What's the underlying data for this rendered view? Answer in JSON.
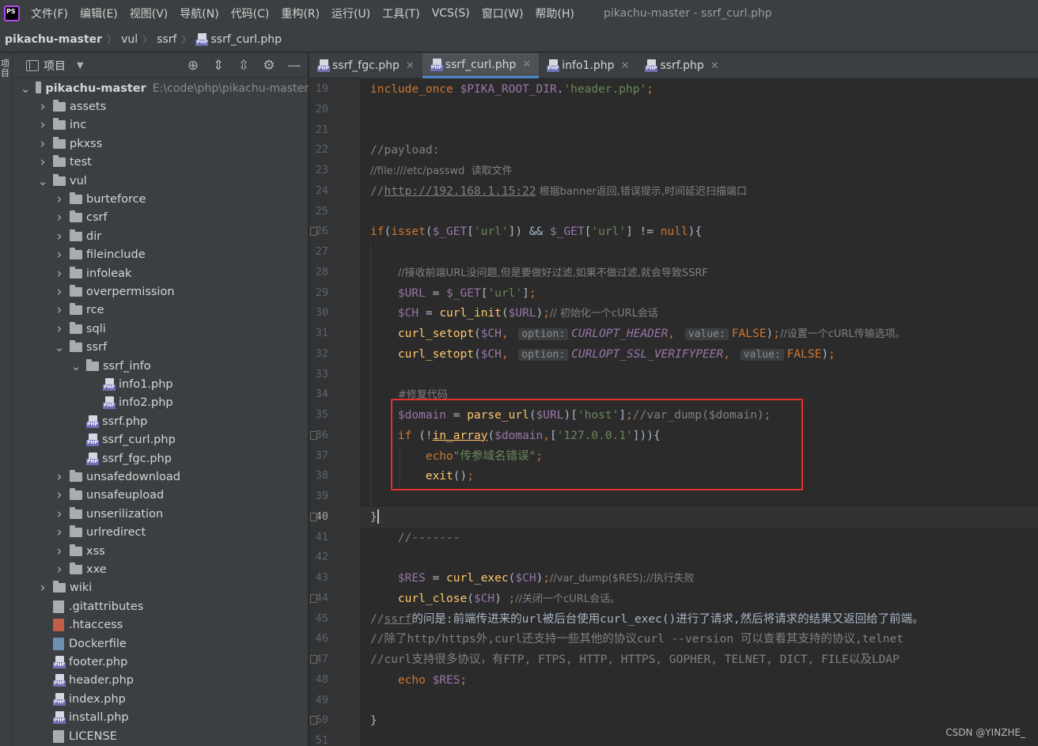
{
  "menubar": {
    "items": [
      "文件(F)",
      "编辑(E)",
      "视图(V)",
      "导航(N)",
      "代码(C)",
      "重构(R)",
      "运行(U)",
      "工具(T)",
      "VCS(S)",
      "窗口(W)",
      "帮助(H)"
    ],
    "window_title": "pikachu-master - ssrf_curl.php"
  },
  "breadcrumb": [
    "pikachu-master",
    "vul",
    "ssrf",
    "ssrf_curl.php"
  ],
  "left_strip_label": "项目",
  "project": {
    "label": "项目",
    "tree": [
      {
        "label": "pikachu-master",
        "path": "E:\\code\\php\\pikachu-master",
        "type": "folder",
        "depth": 0,
        "open": true
      },
      {
        "label": "assets",
        "type": "folder",
        "depth": 1
      },
      {
        "label": "inc",
        "type": "folder",
        "depth": 1
      },
      {
        "label": "pkxss",
        "type": "folder",
        "depth": 1
      },
      {
        "label": "test",
        "type": "folder",
        "depth": 1
      },
      {
        "label": "vul",
        "type": "folder",
        "depth": 1,
        "open": true
      },
      {
        "label": "burteforce",
        "type": "folder",
        "depth": 2
      },
      {
        "label": "csrf",
        "type": "folder",
        "depth": 2
      },
      {
        "label": "dir",
        "type": "folder",
        "depth": 2
      },
      {
        "label": "fileinclude",
        "type": "folder",
        "depth": 2
      },
      {
        "label": "infoleak",
        "type": "folder",
        "depth": 2
      },
      {
        "label": "overpermission",
        "type": "folder",
        "depth": 2
      },
      {
        "label": "rce",
        "type": "folder",
        "depth": 2
      },
      {
        "label": "sqli",
        "type": "folder",
        "depth": 2
      },
      {
        "label": "ssrf",
        "type": "folder",
        "depth": 2,
        "open": true
      },
      {
        "label": "ssrf_info",
        "type": "folder",
        "depth": 3,
        "open": true
      },
      {
        "label": "info1.php",
        "type": "php",
        "depth": 4
      },
      {
        "label": "info2.php",
        "type": "php",
        "depth": 4
      },
      {
        "label": "ssrf.php",
        "type": "php",
        "depth": 3
      },
      {
        "label": "ssrf_curl.php",
        "type": "php",
        "depth": 3
      },
      {
        "label": "ssrf_fgc.php",
        "type": "php",
        "depth": 3
      },
      {
        "label": "unsafedownload",
        "type": "folder",
        "depth": 2
      },
      {
        "label": "unsafeupload",
        "type": "folder",
        "depth": 2
      },
      {
        "label": "unserilization",
        "type": "folder",
        "depth": 2
      },
      {
        "label": "urlredirect",
        "type": "folder",
        "depth": 2
      },
      {
        "label": "xss",
        "type": "folder",
        "depth": 2
      },
      {
        "label": "xxe",
        "type": "folder",
        "depth": 2
      },
      {
        "label": "wiki",
        "type": "folder",
        "depth": 1
      },
      {
        "label": ".gitattributes",
        "type": "file",
        "depth": 1
      },
      {
        "label": ".htaccess",
        "type": "htaccess",
        "depth": 1
      },
      {
        "label": "Dockerfile",
        "type": "docker",
        "depth": 1
      },
      {
        "label": "footer.php",
        "type": "php",
        "depth": 1
      },
      {
        "label": "header.php",
        "type": "php",
        "depth": 1
      },
      {
        "label": "index.php",
        "type": "php",
        "depth": 1
      },
      {
        "label": "install.php",
        "type": "php",
        "depth": 1
      },
      {
        "label": "LICENSE",
        "type": "file",
        "depth": 1
      }
    ]
  },
  "tabs": [
    {
      "label": "ssrf_fgc.php",
      "active": false
    },
    {
      "label": "ssrf_curl.php",
      "active": true
    },
    {
      "label": "info1.php",
      "active": false
    },
    {
      "label": "ssrf.php",
      "active": false
    }
  ],
  "editor": {
    "first_line": 19,
    "current_line": 40,
    "line_numbers": [
      "19",
      "20",
      "21",
      "22",
      "23",
      "24",
      "25",
      "26",
      "27",
      "28",
      "29",
      "30",
      "31",
      "32",
      "33",
      "34",
      "35",
      "36",
      "37",
      "38",
      "39",
      "40",
      "41",
      "42",
      "43",
      "44",
      "45",
      "46",
      "47",
      "48",
      "49",
      "50",
      "51"
    ],
    "lines": [
      [
        [
          "k",
          "include_once "
        ],
        [
          "v",
          "$PIKA_ROOT_DIR"
        ],
        [
          "p",
          "."
        ],
        [
          "s",
          "'header.php'"
        ],
        [
          "k",
          ";"
        ]
      ],
      [],
      [],
      [
        [
          "c",
          "//payload:"
        ]
      ],
      [
        [
          "c",
          "//file:///etc/passwd  读取文件"
        ]
      ],
      [
        [
          "c",
          "//"
        ],
        [
          "cu",
          "http://192.168.1.15:22"
        ],
        [
          "c",
          " 根据banner返回,错误提示,时间延迟扫描端口"
        ]
      ],
      [],
      [
        [
          "k",
          "if"
        ],
        [
          "p",
          "("
        ],
        [
          "k",
          "isset"
        ],
        [
          "p",
          "("
        ],
        [
          "v",
          "$_GET"
        ],
        [
          "p",
          "["
        ],
        [
          "s",
          "'url'"
        ],
        [
          "p",
          "]) && "
        ],
        [
          "v",
          "$_GET"
        ],
        [
          "p",
          "["
        ],
        [
          "s",
          "'url'"
        ],
        [
          "p",
          "] != "
        ],
        [
          "k",
          "null"
        ],
        [
          "p",
          "){"
        ]
      ],
      [],
      [
        [
          "p",
          "    "
        ],
        [
          "c",
          "//接收前端URL没问题,但是要做好过滤,如果不做过滤,就会导致SSRF"
        ]
      ],
      [
        [
          "p",
          "    "
        ],
        [
          "v",
          "$URL"
        ],
        [
          "p",
          " = "
        ],
        [
          "v",
          "$_GET"
        ],
        [
          "p",
          "["
        ],
        [
          "s",
          "'url'"
        ],
        [
          "p",
          "]"
        ],
        [
          "k",
          ";"
        ]
      ],
      [
        [
          "p",
          "    "
        ],
        [
          "v",
          "$CH"
        ],
        [
          "p",
          " = "
        ],
        [
          "f",
          "curl_init"
        ],
        [
          "p",
          "("
        ],
        [
          "v",
          "$URL"
        ],
        [
          "p",
          ")"
        ],
        [
          "k",
          ";"
        ],
        [
          "c",
          "// 初始化一个cURL会话"
        ]
      ],
      [
        [
          "p",
          "    "
        ],
        [
          "f",
          "curl_setopt"
        ],
        [
          "p",
          "("
        ],
        [
          "v",
          "$CH"
        ],
        [
          "k",
          ", "
        ],
        [
          "h",
          "option:"
        ],
        [
          "i",
          "CURLOPT_HEADER"
        ],
        [
          "k",
          ", "
        ],
        [
          "h",
          "value:"
        ],
        [
          "k",
          "FALSE"
        ],
        [
          "p",
          ")"
        ],
        [
          "k",
          ";"
        ],
        [
          "c",
          "//设置一个cURL传输选项。"
        ]
      ],
      [
        [
          "p",
          "    "
        ],
        [
          "f",
          "curl_setopt"
        ],
        [
          "p",
          "("
        ],
        [
          "v",
          "$CH"
        ],
        [
          "k",
          ", "
        ],
        [
          "h",
          "option:"
        ],
        [
          "i",
          "CURLOPT_SSL_VERIFYPEER"
        ],
        [
          "k",
          ", "
        ],
        [
          "h",
          "value:"
        ],
        [
          "k",
          "FALSE"
        ],
        [
          "p",
          ")"
        ],
        [
          "k",
          ";"
        ]
      ],
      [],
      [
        [
          "p",
          "    "
        ],
        [
          "c",
          "#修复代码"
        ]
      ],
      [
        [
          "p",
          "    "
        ],
        [
          "v",
          "$domain"
        ],
        [
          "p",
          " = "
        ],
        [
          "f",
          "parse_url"
        ],
        [
          "p",
          "("
        ],
        [
          "v",
          "$URL"
        ],
        [
          "p",
          ")["
        ],
        [
          "s",
          "'host'"
        ],
        [
          "p",
          "]"
        ],
        [
          "k",
          ";"
        ],
        [
          "c",
          "//var_dump($domain);"
        ]
      ],
      [
        [
          "p",
          "    "
        ],
        [
          "k",
          "if "
        ],
        [
          "p",
          "(!"
        ],
        [
          "fu",
          "in_array"
        ],
        [
          "p",
          "("
        ],
        [
          "v",
          "$domain"
        ],
        [
          "k",
          ","
        ],
        [
          "p",
          "["
        ],
        [
          "s",
          "'127.0.0.1'"
        ],
        [
          "p",
          "])){"
        ]
      ],
      [
        [
          "p",
          "        "
        ],
        [
          "k",
          "echo"
        ],
        [
          "s",
          "\"传参域名错误\""
        ],
        [
          "k",
          ";"
        ]
      ],
      [
        [
          "p",
          "        "
        ],
        [
          "f",
          "exit"
        ],
        [
          "p",
          "()"
        ],
        [
          "k",
          ";"
        ]
      ],
      [],
      [
        [
          "p",
          "}"
        ],
        [
          "caret",
          ""
        ]
      ],
      [
        [
          "p",
          "    "
        ],
        [
          "c",
          "//-------"
        ]
      ],
      [],
      [
        [
          "p",
          "    "
        ],
        [
          "v",
          "$RES"
        ],
        [
          "p",
          " = "
        ],
        [
          "f",
          "curl_exec"
        ],
        [
          "p",
          "("
        ],
        [
          "v",
          "$CH"
        ],
        [
          "p",
          ")"
        ],
        [
          "k",
          ";"
        ],
        [
          "c",
          "//var_dump($RES);//执行失败"
        ]
      ],
      [
        [
          "p",
          "    "
        ],
        [
          "f",
          "curl_close"
        ],
        [
          "p",
          "("
        ],
        [
          "v",
          "$CH"
        ],
        [
          "p",
          ") "
        ],
        [
          "k",
          ";"
        ],
        [
          "c",
          "//关闭一个cURL会话。"
        ]
      ],
      [
        [
          "p",
          "//"
        ],
        [
          "pu",
          "ssrf"
        ],
        [
          "p",
          "的问是:前端传进来的url被后台使用curl_exec()进行了请求,然后将请求的结果又返回给了前端。"
        ]
      ],
      [
        [
          "p",
          "//除了http/https外,curl还支持一些其他的协议curl --version 可以查看其支持的协议,telnet"
        ]
      ],
      [
        [
          "p",
          "//curl支持很多协议，有FTP, FTPS, HTTP, HTTPS, GOPHER, TELNET, DICT, FILE以及LDAP"
        ]
      ],
      [
        [
          "p",
          "    "
        ],
        [
          "k",
          "echo "
        ],
        [
          "v",
          "$RES"
        ],
        [
          "k",
          ";"
        ]
      ],
      [],
      [
        [
          "p",
          "}"
        ]
      ],
      []
    ]
  },
  "watermark": "CSDN @YINZHE_"
}
